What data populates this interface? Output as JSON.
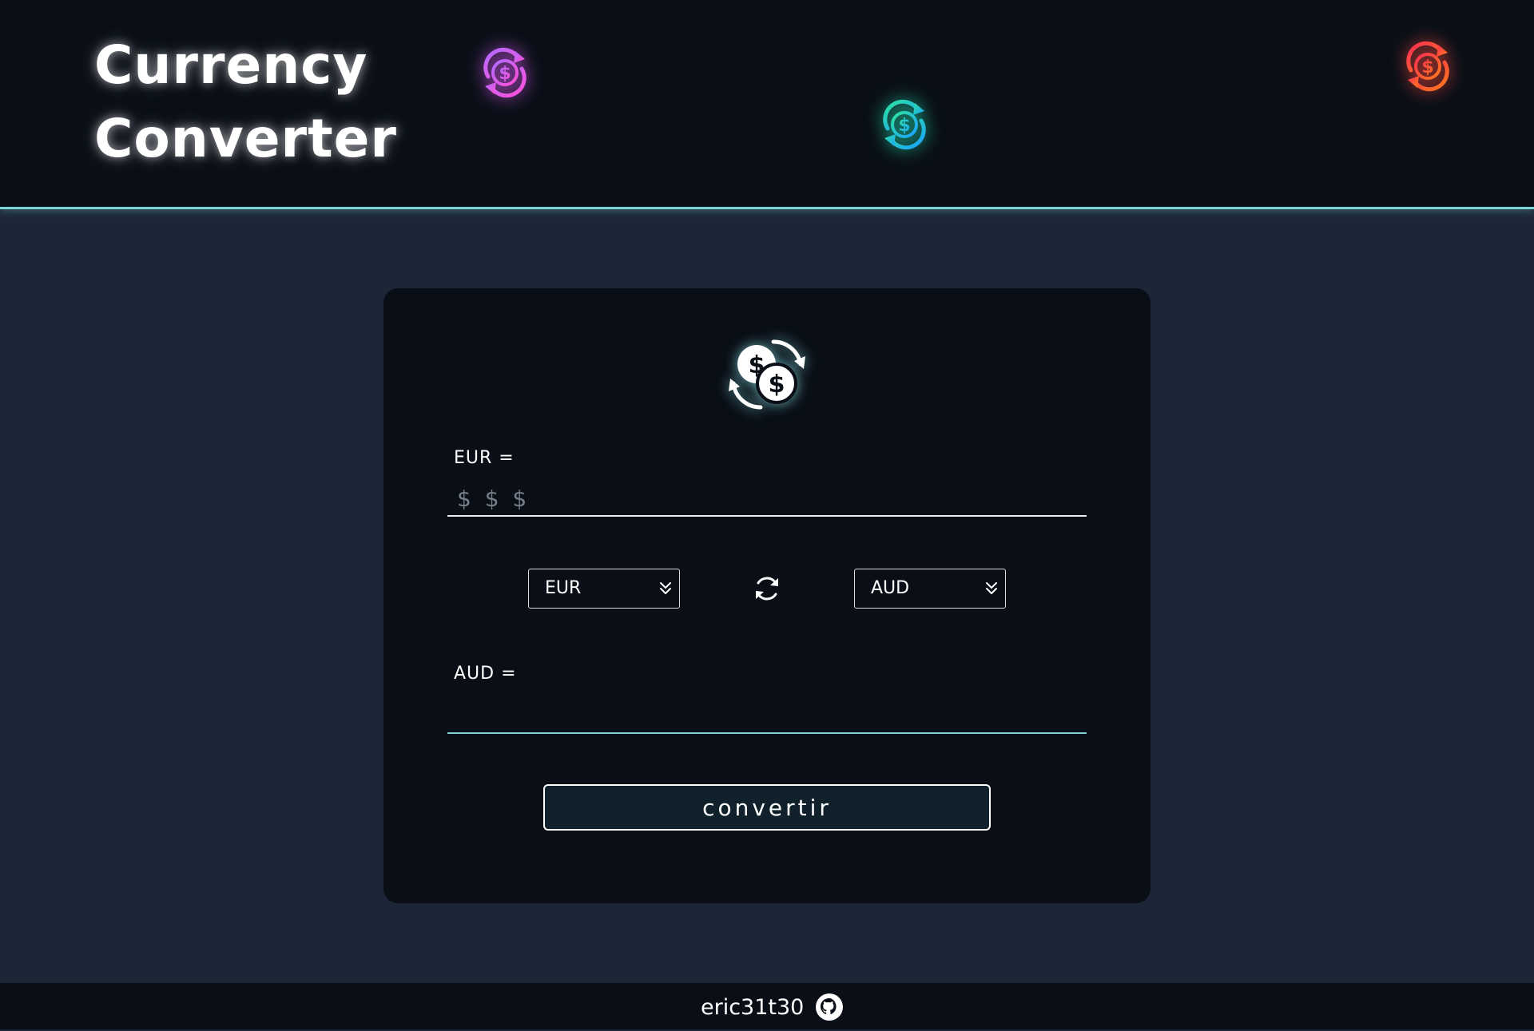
{
  "header": {
    "title_line1": "Currency",
    "title_line2": "Converter",
    "deco_icons": [
      {
        "name": "dollar-exchange-icon",
        "color_start": "#b06bff",
        "color_end": "#ff4fd8"
      },
      {
        "name": "dollar-exchange-icon",
        "color_start": "#2de3a0",
        "color_end": "#1aa0ff"
      },
      {
        "name": "dollar-exchange-icon",
        "color_start": "#ff2d55",
        "color_end": "#ff7a1a"
      }
    ]
  },
  "converter": {
    "logo_icon": "coins-exchange-icon",
    "from_label": "EUR =",
    "amount_placeholder": "$ $ $",
    "amount_value": "",
    "from_currency": "EUR",
    "to_currency": "AUD",
    "swap_icon": "swap-refresh-icon",
    "to_label": "AUD =",
    "result_value": "",
    "convert_label": "convertir"
  },
  "footer": {
    "username": "eric31t30",
    "icon": "github-icon"
  },
  "colors": {
    "accent": "#7fd6d9",
    "background": "#1c2636",
    "panel": "#0a0f17"
  }
}
